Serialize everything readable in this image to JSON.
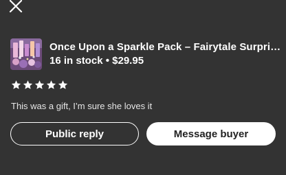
{
  "header": {
    "close_icon": "close-icon"
  },
  "product": {
    "title": "Once Upon a Sparkle Pack – Fairytale Surprise…",
    "stock": "16 in stock",
    "separator": "•",
    "price": "$29.95"
  },
  "review": {
    "rating": 5,
    "max_rating": 5,
    "text": "This was a gift, I’m sure she loves it"
  },
  "actions": {
    "public_reply_label": "Public reply",
    "message_buyer_label": "Message buyer"
  },
  "colors": {
    "background": "#333333",
    "text": "#ffffff",
    "button_solid_bg": "#ffffff",
    "button_solid_text": "#222222"
  }
}
